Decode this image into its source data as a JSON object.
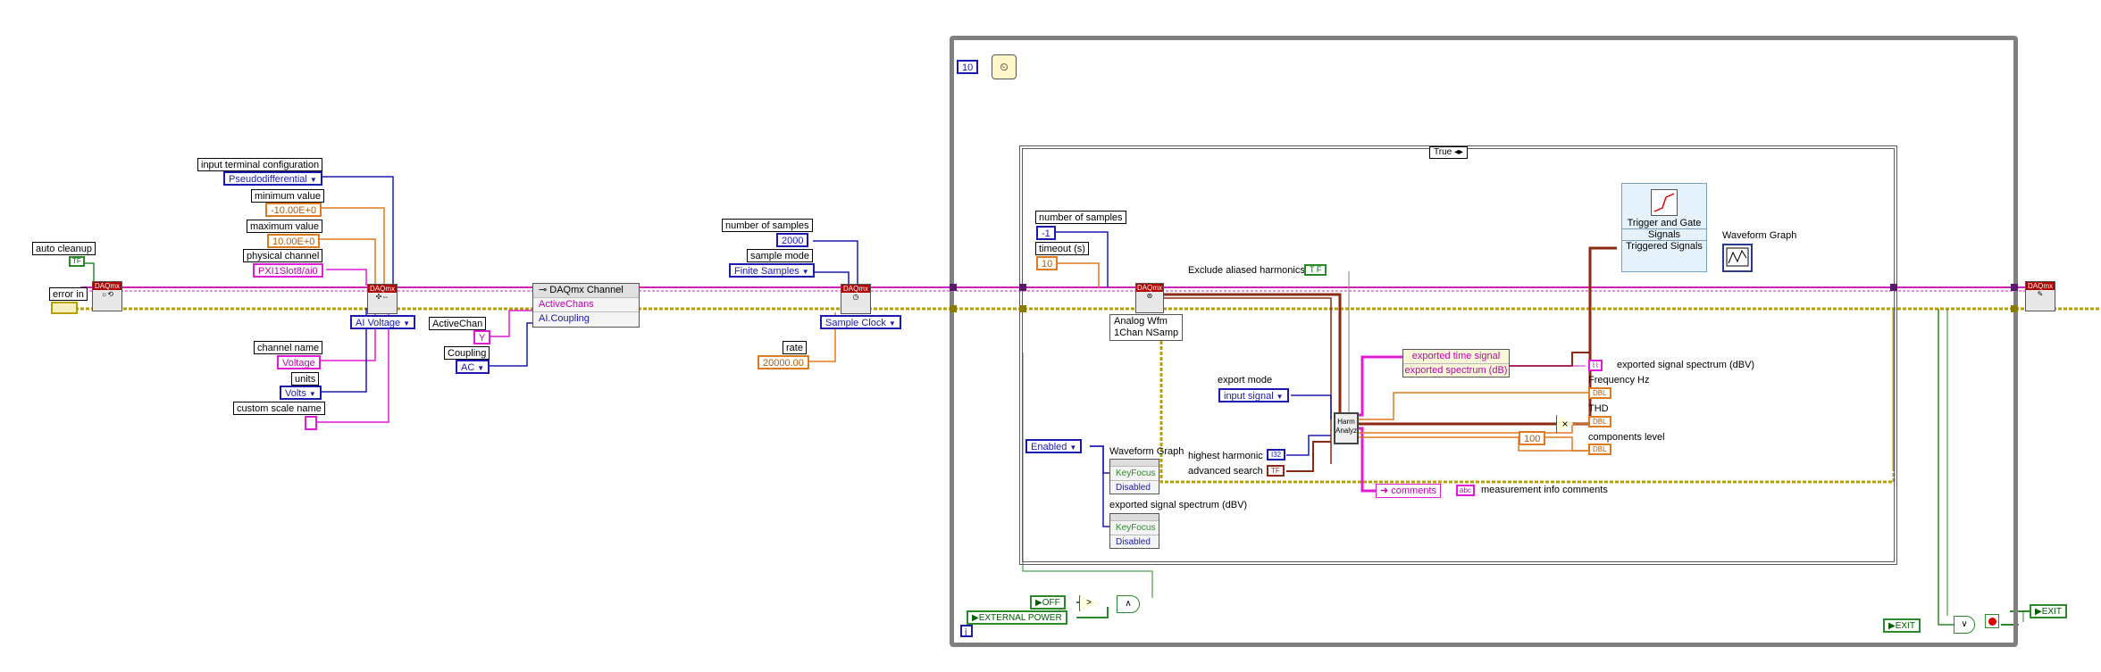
{
  "left": {
    "auto_cleanup": "auto cleanup",
    "auto_cleanup_const": "TF",
    "error_in": "error in",
    "input_terminal_configuration": "input terminal configuration",
    "pseudodiff": "Pseudodifferential",
    "minimum_value": "minimum value",
    "min_val": "-10.00E+0",
    "maximum_value": "maximum value",
    "max_val": "10.00E+0",
    "physical_channel": "physical channel",
    "phys_val": "PXI1Slot8/ai0",
    "ai_voltage": "AI Voltage",
    "channel_name": "channel name",
    "channel_val": "Voltage",
    "units": "units",
    "units_val": "Volts",
    "custom_scale_name": "custom scale name",
    "daqmx_channel": "DAQmx Channel",
    "active_chans": "ActiveChans",
    "ai_coupling": "AI.Coupling",
    "active_chan": "ActiveChan",
    "active_chan_val": "Y",
    "coupling": "Coupling",
    "coupling_val": "AC",
    "number_of_samples": "number of samples",
    "nsamples_val": "2000",
    "sample_mode": "sample mode",
    "sample_mode_val": "Finite Samples",
    "sample_clock": "Sample Clock",
    "rate": "rate",
    "rate_val": "20000.00",
    "daqmx": "DAQmx"
  },
  "loop": {
    "wait_const": "10",
    "case_selector": "True",
    "number_of_samples": "number of samples",
    "num_samples_val": "-1",
    "timeout": "timeout (s)",
    "timeout_val": "10",
    "analog_wfm": "Analog Wfm",
    "one_chan": "1Chan NSamp",
    "exclude_aliased": "Exclude aliased harmonics",
    "exclude_val": "T F",
    "trigger_gate": "Trigger and Gate",
    "signals": "Signals",
    "triggered_signals": "Triggered Signals",
    "waveform_graph": "Waveform Graph",
    "export_mode": "export mode",
    "export_mode_val": "input signal",
    "exported_time_signal": "exported time signal",
    "exported_spectrum": "exported spectrum (dB)",
    "exported_signal_spectrum": "exported signal spectrum (dBV)",
    "dbl": "DBL",
    "frequency": "Frequency Hz",
    "thd": "THD",
    "components_level": "components level",
    "const_100": "100",
    "highest_harmonic": "highest harmonic",
    "highest_harmonic_val": "I32",
    "advanced_search": "advanced search",
    "advanced_search_val": "TF",
    "harm_analyz": "Harm Analyz",
    "comments": "comments",
    "abc": "abc",
    "measurement_info": "measurement info comments",
    "enabled": "Enabled",
    "wg_label": "Waveform Graph",
    "keyfocus": "KeyFocus",
    "disabled": "Disabled",
    "ess_label": "exported signal spectrum (dBV)",
    "keyfocus2": "KeyFocus",
    "disabled2": "Disabled",
    "off": "OFF",
    "external_power": "EXTERNAL POWER",
    "loop_iter": "i",
    "exit": "EXIT",
    "exit2": "EXIT"
  },
  "colors": {
    "error_wire": "#b8a000",
    "task_wire": "#d020c0",
    "loop_border": "#808080",
    "case_border": "#606060",
    "numeric_orange": "#e07a1f",
    "enum_blue": "#1a1ab0",
    "bool_green": "#2a8a2a",
    "daqmx_red": "#b00000"
  }
}
